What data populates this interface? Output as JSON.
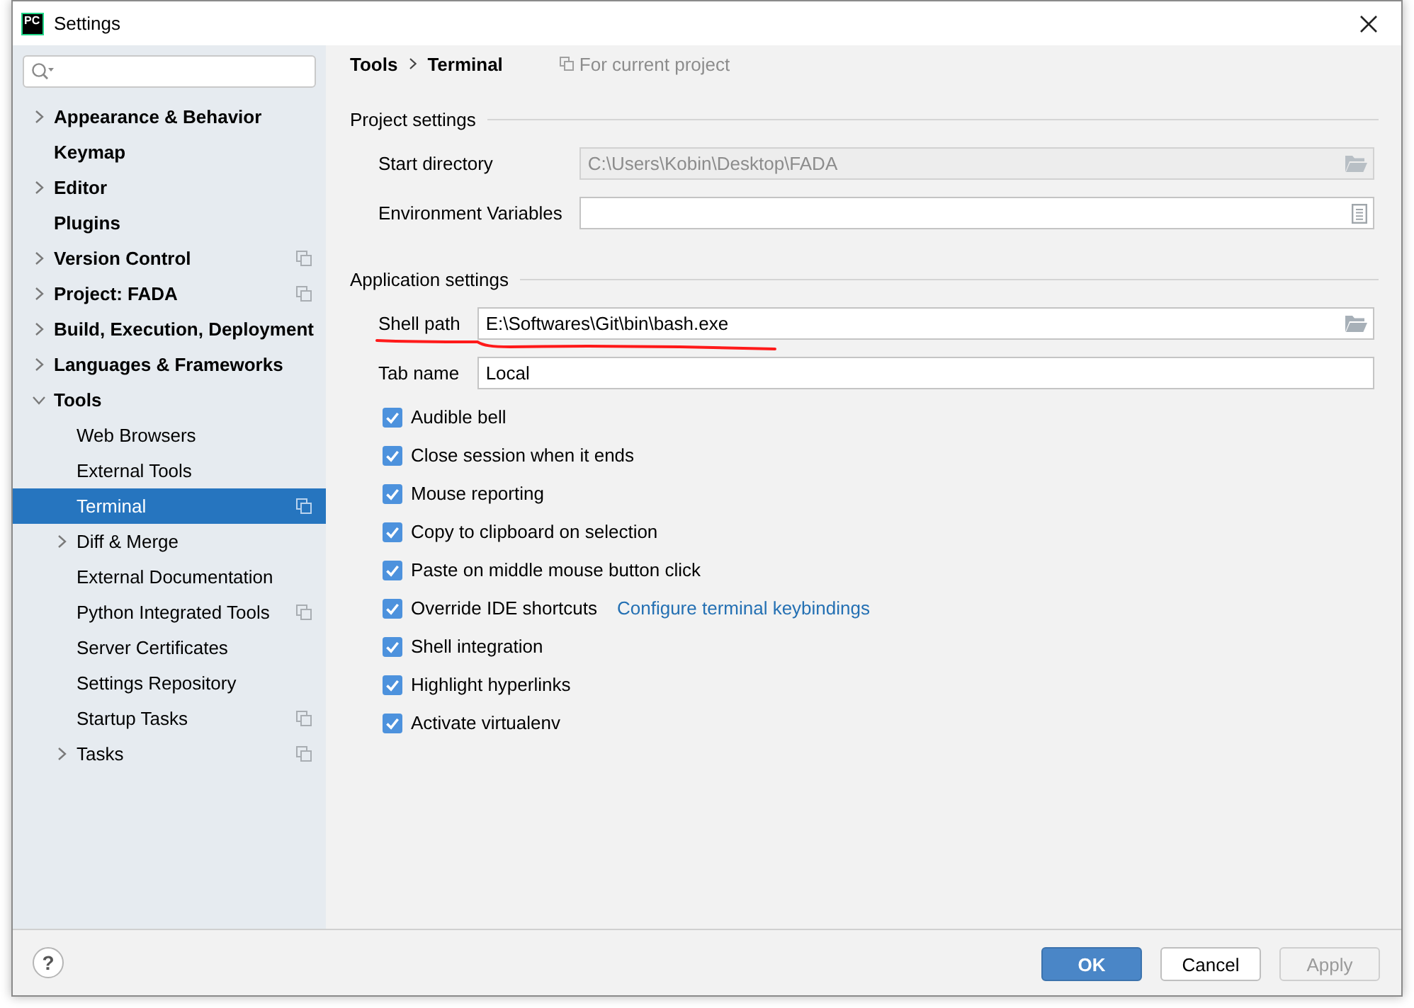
{
  "window": {
    "title": "Settings",
    "logo": "PC"
  },
  "sidebar": {
    "items": [
      {
        "label": "Appearance & Behavior",
        "kind": "group",
        "expanded": false,
        "selected": false,
        "project_scoped": false
      },
      {
        "label": "Keymap",
        "kind": "page",
        "expanded": false,
        "selected": false,
        "project_scoped": false
      },
      {
        "label": "Editor",
        "kind": "group",
        "expanded": false,
        "selected": false,
        "project_scoped": false
      },
      {
        "label": "Plugins",
        "kind": "page",
        "expanded": false,
        "selected": false,
        "project_scoped": false
      },
      {
        "label": "Version Control",
        "kind": "group",
        "expanded": false,
        "selected": false,
        "project_scoped": true
      },
      {
        "label": "Project: FADA",
        "kind": "group",
        "expanded": false,
        "selected": false,
        "project_scoped": true
      },
      {
        "label": "Build, Execution, Deployment",
        "kind": "group",
        "expanded": false,
        "selected": false,
        "project_scoped": false
      },
      {
        "label": "Languages & Frameworks",
        "kind": "group",
        "expanded": false,
        "selected": false,
        "project_scoped": false
      },
      {
        "label": "Tools",
        "kind": "group",
        "expanded": true,
        "selected": false,
        "project_scoped": false,
        "children": [
          {
            "label": "Web Browsers",
            "kind": "page",
            "expanded": false,
            "selected": false,
            "project_scoped": false
          },
          {
            "label": "External Tools",
            "kind": "page",
            "expanded": false,
            "selected": false,
            "project_scoped": false
          },
          {
            "label": "Terminal",
            "kind": "page",
            "expanded": false,
            "selected": true,
            "project_scoped": true
          },
          {
            "label": "Diff & Merge",
            "kind": "group",
            "expanded": false,
            "selected": false,
            "project_scoped": false
          },
          {
            "label": "External Documentation",
            "kind": "page",
            "expanded": false,
            "selected": false,
            "project_scoped": false
          },
          {
            "label": "Python Integrated Tools",
            "kind": "page",
            "expanded": false,
            "selected": false,
            "project_scoped": true
          },
          {
            "label": "Server Certificates",
            "kind": "page",
            "expanded": false,
            "selected": false,
            "project_scoped": false
          },
          {
            "label": "Settings Repository",
            "kind": "page",
            "expanded": false,
            "selected": false,
            "project_scoped": false
          },
          {
            "label": "Startup Tasks",
            "kind": "page",
            "expanded": false,
            "selected": false,
            "project_scoped": true
          },
          {
            "label": "Tasks",
            "kind": "group",
            "expanded": false,
            "selected": false,
            "project_scoped": true
          }
        ]
      }
    ]
  },
  "content": {
    "breadcrumb": [
      "Tools",
      "Terminal"
    ],
    "scope_note": "For current project",
    "sections": [
      {
        "title": "Project settings",
        "fields": [
          {
            "label": "Start directory",
            "value": "C:\\Users\\Kobin\\Desktop\\FADA",
            "kind": "folder",
            "disabled": true,
            "underlined": false
          },
          {
            "label": "Environment Variables",
            "kind": "list",
            "disabled": false,
            "underlined": false
          }
        ]
      },
      {
        "title": "Application settings",
        "fields": [
          {
            "label": "Shell path",
            "value": "E:\\Softwares\\Git\\bin\\bash.exe",
            "kind": "folder",
            "disabled": false,
            "underlined": true
          },
          {
            "label": "Tab name",
            "value": "Local",
            "kind": "text",
            "disabled": false,
            "underlined": false
          }
        ],
        "options": [
          {
            "label": "Audible bell",
            "checked": true
          },
          {
            "label": "Close session when it ends",
            "checked": true
          },
          {
            "label": "Mouse reporting",
            "checked": true
          },
          {
            "label": "Copy to clipboard on selection",
            "checked": true
          },
          {
            "label": "Paste on middle mouse button click",
            "checked": true
          },
          {
            "label": "Override IDE shortcuts",
            "checked": true,
            "link": "Configure terminal keybindings"
          },
          {
            "label": "Shell integration",
            "checked": true
          },
          {
            "label": "Highlight hyperlinks",
            "checked": true
          },
          {
            "label": "Activate virtualenv",
            "checked": true
          }
        ]
      }
    ]
  },
  "footer": {
    "help": "?",
    "buttons": [
      {
        "label": "OK",
        "kind": "primary",
        "disabled": false
      },
      {
        "label": "Cancel",
        "kind": "secondary",
        "disabled": false
      },
      {
        "label": "Apply",
        "kind": "secondary",
        "disabled": true
      }
    ]
  }
}
